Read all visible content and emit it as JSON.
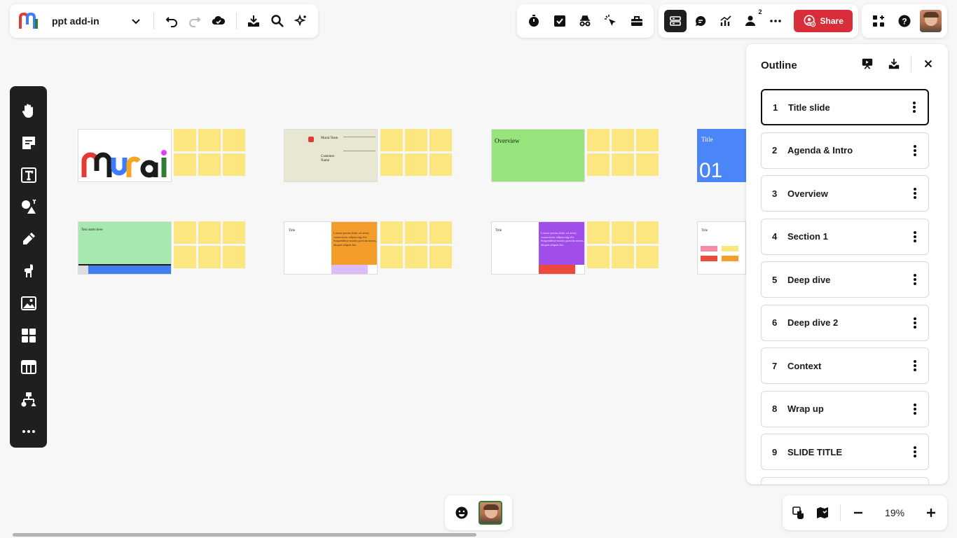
{
  "board": {
    "title": "ppt add-in"
  },
  "colors": {
    "share": "#d92d3a",
    "sticky": "#fbe67f",
    "dark": "#1f1f1f"
  },
  "toolbar_left": [
    "logo-icon",
    "chevron-down-icon",
    "undo-icon",
    "redo-icon",
    "cloud-sync-icon",
    "download-icon",
    "search-icon",
    "sparkle-icon"
  ],
  "toolbar_mid1": [
    "timer-icon",
    "checkbox-icon",
    "incognito-icon",
    "cursor-click-icon",
    "toolbox-icon"
  ],
  "toolbar_mid2": {
    "collaborators_count": "2",
    "share_label": "Share"
  },
  "side_tools": [
    "hand-icon",
    "sticky-note-icon",
    "text-icon",
    "shapes-icon",
    "pen-icon",
    "llama-icon",
    "image-icon",
    "templates-icon",
    "table-icon",
    "diagram-icon",
    "more-icon"
  ],
  "slides": [
    {
      "label": "Mural"
    },
    {
      "label": "Mural Team",
      "sub": "Customer Name"
    },
    {
      "label": "Overview"
    },
    {
      "label": "Title",
      "number": "01"
    },
    {
      "label": "Text starts here"
    },
    {
      "label": "Title",
      "body": "Lorem ipsum dolor sit amet, consectetur adipiscing elit. Suspendisse mattis gravida metus, aliquet aliquet leo."
    },
    {
      "label": "Title",
      "body": "Lorem ipsum dolor sit amet, consectetur adipiscing elit. Suspendisse mattis gravida metus, aliquet aliquet leo."
    },
    {
      "label": "Title"
    }
  ],
  "outline": {
    "title": "Outline",
    "items": [
      {
        "num": "1",
        "label": "Title slide"
      },
      {
        "num": "2",
        "label": "Agenda & Intro"
      },
      {
        "num": "3",
        "label": "Overview"
      },
      {
        "num": "4",
        "label": "Section 1"
      },
      {
        "num": "5",
        "label": "Deep dive"
      },
      {
        "num": "6",
        "label": "Deep dive 2"
      },
      {
        "num": "7",
        "label": "Context"
      },
      {
        "num": "8",
        "label": "Wrap up"
      },
      {
        "num": "9",
        "label": "SLIDE TITLE"
      }
    ]
  },
  "zoom": {
    "value": "19%"
  }
}
